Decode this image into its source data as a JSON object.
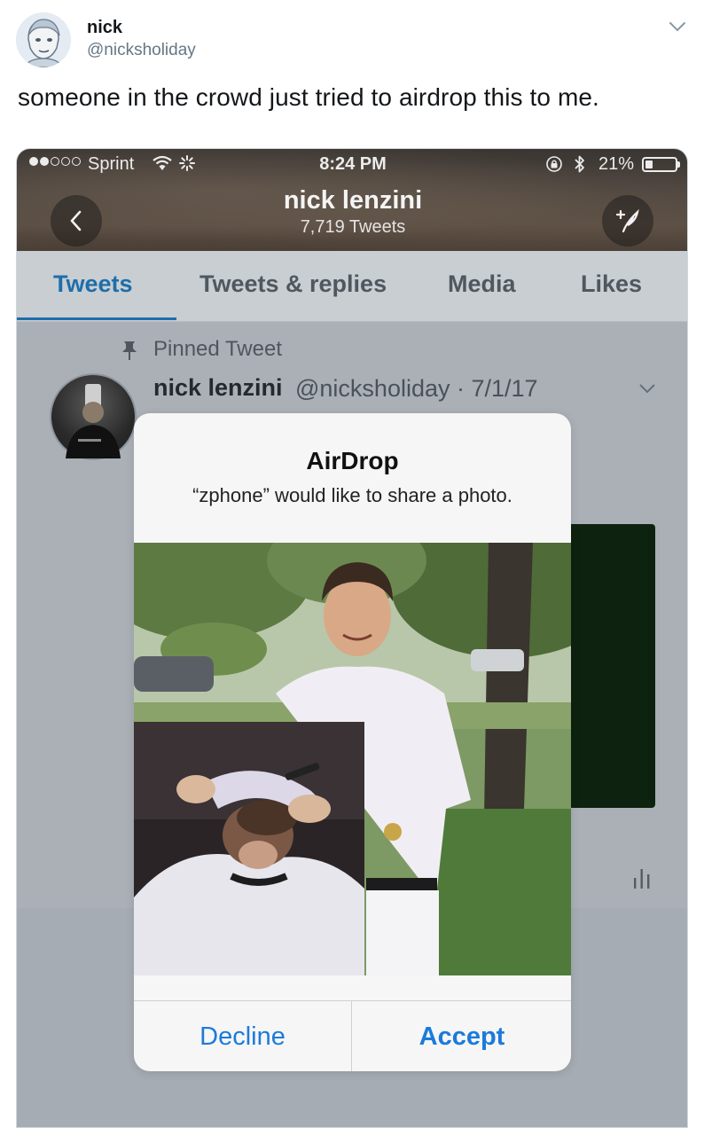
{
  "author": {
    "name": "nick",
    "handle": "@nicksholiday"
  },
  "tweet": {
    "text": "someone in the crowd just tried to airdrop this to me."
  },
  "screenshot": {
    "status_bar": {
      "carrier": "Sprint",
      "time": "8:24 PM",
      "battery": "21%"
    },
    "profile": {
      "name": "nick lenzini",
      "tweet_count": "7,719 Tweets"
    },
    "tabs": [
      {
        "label": "Tweets",
        "active": true
      },
      {
        "label": "Tweets & replies",
        "active": false
      },
      {
        "label": "Media",
        "active": false
      },
      {
        "label": "Likes",
        "active": false
      }
    ],
    "pinned": {
      "label": "Pinned Tweet",
      "name": "nick lenzini",
      "handle_date": "@nicksholiday · 7/1/17"
    },
    "airdrop": {
      "title": "AirDrop",
      "message": "“zphone” would like to share a photo.",
      "decline_label": "Decline",
      "accept_label": "Accept"
    }
  },
  "colors": {
    "link_blue": "#1b7bd9",
    "tab_active": "#1f6ea9",
    "handle_gray": "#657786"
  }
}
